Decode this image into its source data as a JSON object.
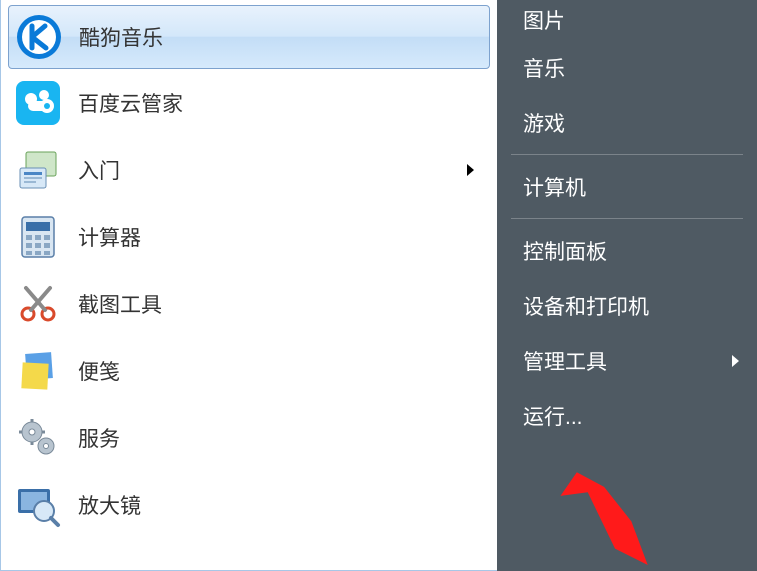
{
  "left": {
    "items": [
      {
        "id": "kugou",
        "label": "酷狗音乐",
        "selected": true,
        "submenu": false
      },
      {
        "id": "baiduyun",
        "label": "百度云管家",
        "selected": false,
        "submenu": false
      },
      {
        "id": "gettingstarted",
        "label": "入门",
        "selected": false,
        "submenu": true
      },
      {
        "id": "calculator",
        "label": "计算器",
        "selected": false,
        "submenu": false
      },
      {
        "id": "snipping",
        "label": "截图工具",
        "selected": false,
        "submenu": false
      },
      {
        "id": "stickynotes",
        "label": "便笺",
        "selected": false,
        "submenu": false
      },
      {
        "id": "services",
        "label": "服务",
        "selected": false,
        "submenu": false
      },
      {
        "id": "magnifier",
        "label": "放大镜",
        "selected": false,
        "submenu": false
      }
    ]
  },
  "right": {
    "items": [
      {
        "id": "pictures",
        "label": "图片",
        "submenu": false
      },
      {
        "id": "music",
        "label": "音乐",
        "submenu": false
      },
      {
        "id": "games",
        "label": "游戏",
        "submenu": false
      },
      {
        "id": "computer",
        "label": "计算机",
        "submenu": false,
        "sepBefore": true
      },
      {
        "id": "controlpanel",
        "label": "控制面板",
        "submenu": false,
        "sepBefore": true
      },
      {
        "id": "devices",
        "label": "设备和打印机",
        "submenu": false
      },
      {
        "id": "admintools",
        "label": "管理工具",
        "submenu": true
      },
      {
        "id": "run",
        "label": "运行...",
        "submenu": false
      }
    ]
  }
}
